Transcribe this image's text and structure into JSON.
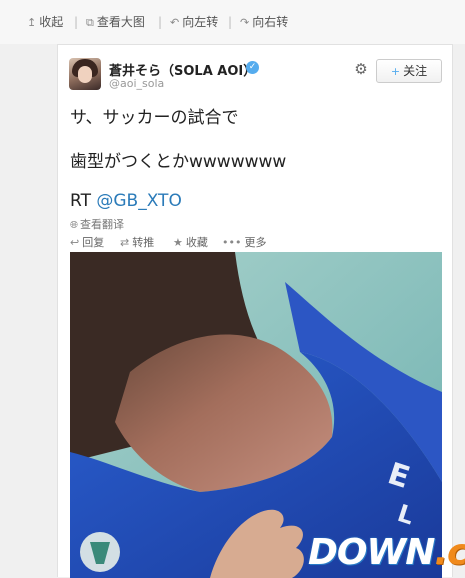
{
  "toolbar": {
    "collapse_label": "收起",
    "view_original_label": "查看大图",
    "rotate_left_label": "向左转",
    "rotate_right_label": "向右转",
    "separator": "|"
  },
  "tweet": {
    "user_name": "蒼井そら（SOLA AOI）",
    "handle": "@aoi_sola",
    "verified_mark": "✓",
    "follow_label": "关注",
    "follow_plus": "+",
    "lines": [
      "サ、サッカーの試合で",
      "歯型がつくとかwwwwwww"
    ],
    "rt_prefix": "RT ",
    "rt_mention": "@GB_XTO",
    "translate_label": "查看翻译",
    "actions": {
      "reply": "回复",
      "retweet": "转推",
      "favorite": "收藏",
      "more": "更多"
    }
  },
  "watermark": {
    "part1": "DOWN",
    "part2": ".cc"
  },
  "icons": {
    "collapse": "up-arrow-icon",
    "view_original": "external-link-icon",
    "rotate_left": "rotate-left-icon",
    "rotate_right": "rotate-right-icon",
    "gear": "gear-icon",
    "globe": "globe-icon",
    "reply": "reply-icon",
    "retweet": "retweet-icon",
    "favorite": "star-icon",
    "more": "more-dots-icon"
  },
  "colors": {
    "link": "#2b7bb9",
    "verified": "#55acee",
    "jersey_blue": "#1f4fbf",
    "watermark_orange": "#f08a1c"
  }
}
